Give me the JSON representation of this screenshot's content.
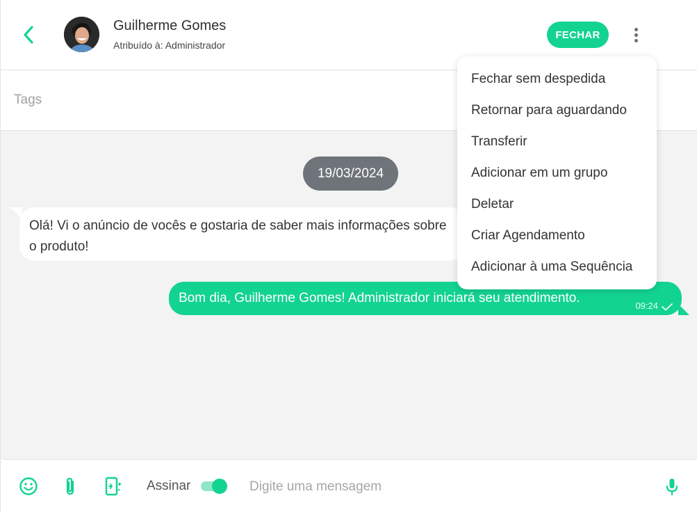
{
  "header": {
    "contact_name": "Guilherme Gomes",
    "assigned_label": "Atribuído à: Administrador",
    "close_label": "FECHAR",
    "accent_color": "#13d391"
  },
  "tags": {
    "placeholder": "Tags"
  },
  "chat": {
    "date_divider": "19/03/2024",
    "messages": [
      {
        "direction": "incoming",
        "text": "Olá! Vi o anúncio de vocês e gostaria de saber mais informações sobre o produto!"
      },
      {
        "direction": "outgoing",
        "text": "Bom dia, Guilherme Gomes! Administrador iniciará seu atendimento.",
        "time": "09:24",
        "status": "sent-check-icon"
      }
    ]
  },
  "menu": {
    "items": [
      "Fechar sem despedida",
      "Retornar para aguardando",
      "Transferir",
      "Adicionar em um grupo",
      "Deletar",
      "Criar Agendamento",
      "Adicionar à uma Sequência"
    ]
  },
  "composer": {
    "sign_label": "Assinar",
    "sign_enabled": true,
    "placeholder": "Digite uma mensagem",
    "icons": [
      "emoji-icon",
      "attachment-icon",
      "quick-reply-icon",
      "microphone-icon"
    ]
  }
}
